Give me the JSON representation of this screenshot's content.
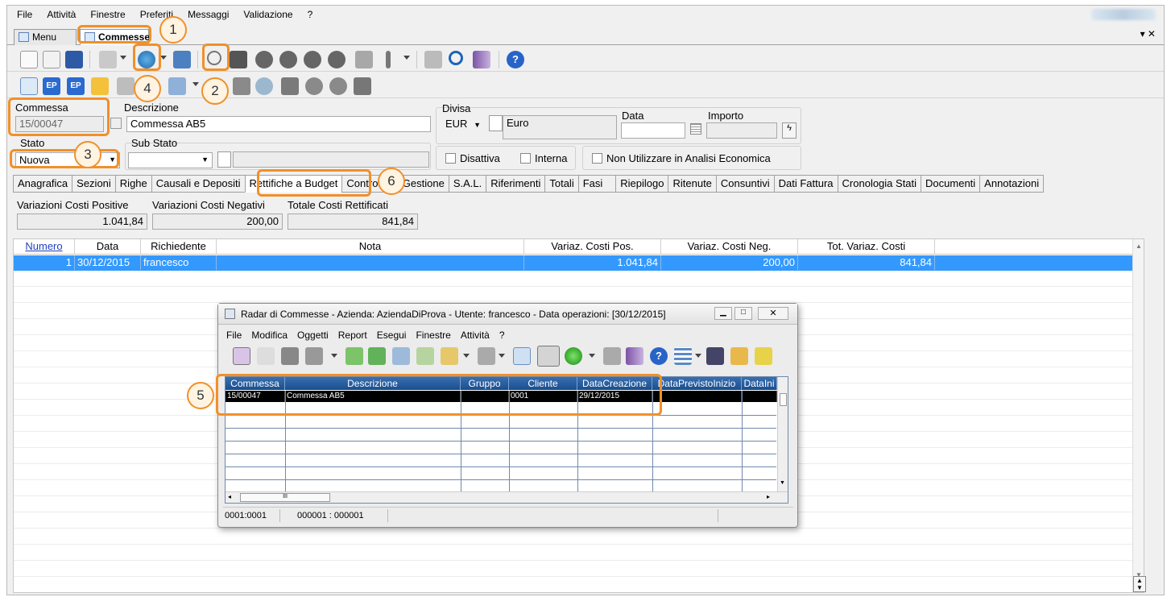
{
  "menubar": [
    "File",
    "Attività",
    "Finestre",
    "Preferiti",
    "Messaggi",
    "Validazione",
    "?"
  ],
  "window_tabs": [
    {
      "label": "Menu"
    },
    {
      "label": "Commesse"
    }
  ],
  "window_close_glyph": "▾ ✕",
  "callouts": [
    "1",
    "2",
    "3",
    "4",
    "5",
    "6"
  ],
  "form": {
    "commessa_label": "Commessa",
    "commessa_value": "15/00047",
    "descrizione_label": "Descrizione",
    "descrizione_value": "Commessa AB5",
    "divisa_label": "Divisa",
    "divisa_value": "EUR",
    "divisa_desc": "Euro",
    "data_label": "Data",
    "importo_label": "Importo",
    "stato_label": "Stato",
    "stato_value": "Nuova",
    "substato_label": "Sub Stato",
    "disattiva_label": "Disattiva",
    "interna_label": "Interna",
    "non_utilizzare_label": "Non Utilizzare in Analisi Economica"
  },
  "tabs": [
    "Anagrafica",
    "Sezioni",
    "Righe",
    "Causali e Depositi",
    "Rettifiche a Budget",
    "Controllo di Gestione",
    "S.A.L.",
    "Riferimenti",
    "Totali",
    "Fasi",
    "Riepilogo",
    "Ritenute",
    "Consuntivi",
    "Dati Fattura",
    "Cronologia Stati",
    "Documenti",
    "Annotazioni"
  ],
  "totals": {
    "pos_label": "Variazioni Costi Positive",
    "pos_value": "1.041,84",
    "neg_label": "Variazioni Costi Negativi",
    "neg_value": "200,00",
    "tot_label": "Totale Costi Rettificati",
    "tot_value": "841,84"
  },
  "grid": {
    "headers": [
      "Numero",
      "Data",
      "Richiedente",
      "Nota",
      "Variaz. Costi Pos.",
      "Variaz. Costi Neg.",
      "Tot. Variaz. Costi"
    ],
    "row": [
      "1",
      "30/12/2015",
      "francesco",
      "",
      "1.041,84",
      "200,00",
      "841,84"
    ]
  },
  "child": {
    "title": "Radar di Commesse - Azienda: AziendaDiProva - Utente: francesco - Data operazioni: [30/12/2015]",
    "menu": [
      "File",
      "Modifica",
      "Oggetti",
      "Report",
      "Esegui",
      "Finestre",
      "Attività",
      "?"
    ],
    "headers": [
      "Commessa",
      "Descrizione",
      "Gruppo",
      "Cliente",
      "DataCreazione",
      "DataPrevistoInizio",
      "DataIni"
    ],
    "row": [
      "15/00047",
      "Commessa AB5",
      "",
      "0001",
      "29/12/2015",
      "",
      ""
    ],
    "status_left": "0001:0001",
    "status_mid": "000001 : 000001",
    "hscroll_grip": "III"
  },
  "colors": {
    "selection": "#3399ff",
    "callout": "#f0902a",
    "child_header": "#1f5797"
  }
}
